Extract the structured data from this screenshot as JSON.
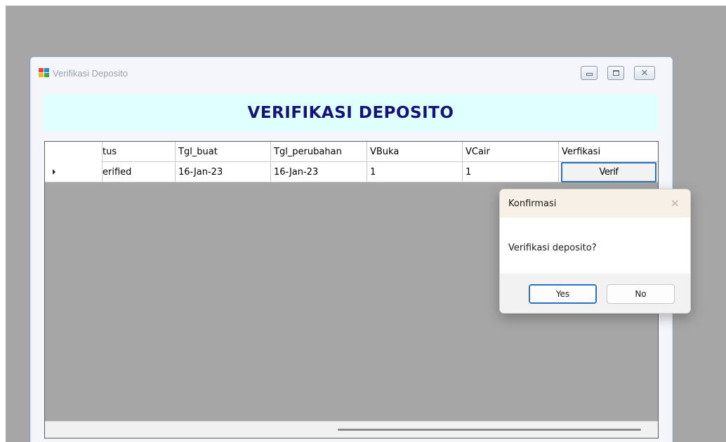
{
  "window": {
    "title": "Verifikasi Deposito",
    "controls": {
      "minimize": "minimize-icon",
      "maximize": "maximize-icon",
      "close": "✕"
    }
  },
  "header": {
    "heading": "VERIFIKASI DEPOSITO",
    "background": "#e0ffff",
    "text_color": "#141478"
  },
  "grid": {
    "columns": [
      "tus",
      "Tgl_buat",
      "Tgl_perubahan",
      "VBuka",
      "VCair",
      "Verfikasi"
    ],
    "rows": [
      {
        "status": "erified",
        "tgl_buat": "16-Jan-23",
        "tgl_perubahan": "16-Jan-23",
        "vbuka": "1",
        "vcair": "1",
        "verif_button": "Verif"
      }
    ]
  },
  "dialog": {
    "title": "Konfirmasi",
    "close_glyph": "✕",
    "message": "Verifikasi deposito?",
    "yes_label": "Yes",
    "no_label": "No"
  },
  "colors": {
    "desktop": "#a6a6a6",
    "accent": "#2d6fc2"
  }
}
